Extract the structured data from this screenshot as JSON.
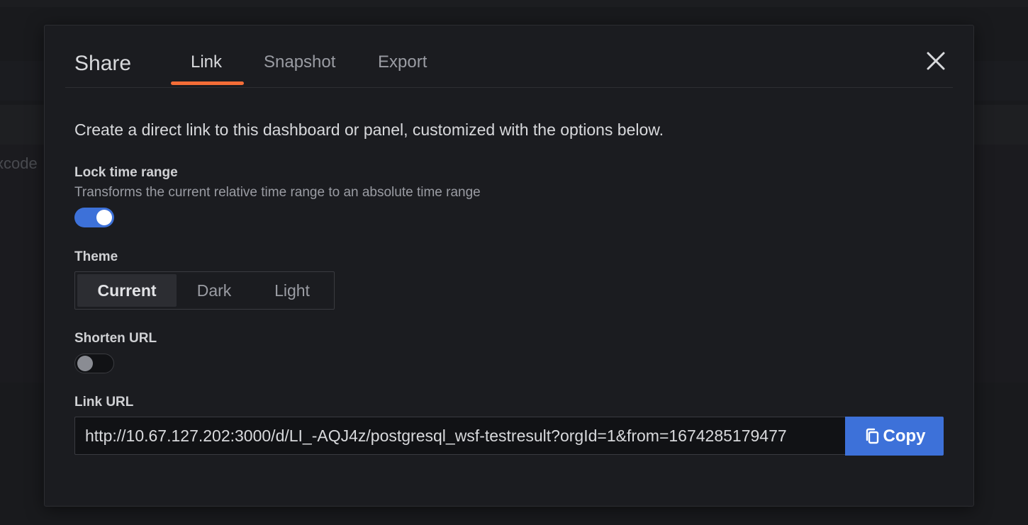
{
  "background": {
    "partial_text": "xcode"
  },
  "modal": {
    "title": "Share",
    "tabs": [
      {
        "label": "Link",
        "active": true
      },
      {
        "label": "Snapshot",
        "active": false
      },
      {
        "label": "Export",
        "active": false
      }
    ],
    "close_icon": "close-icon",
    "description": "Create a direct link to this dashboard or panel, customized with the options below.",
    "lock_time_range": {
      "label": "Lock time range",
      "description": "Transforms the current relative time range to an absolute time range",
      "enabled": true
    },
    "theme": {
      "label": "Theme",
      "options": [
        "Current",
        "Dark",
        "Light"
      ],
      "selected": "Current"
    },
    "shorten_url": {
      "label": "Shorten URL",
      "enabled": false
    },
    "link_url": {
      "label": "Link URL",
      "value": "http://10.67.127.202:3000/d/LI_-AQJ4z/postgresql_wsf-testresult?orgId=1&from=1674285179477",
      "copy_label": "Copy",
      "copy_icon": "copy-icon"
    }
  },
  "colors": {
    "accent_tab": "#f46d37",
    "primary_button": "#3d71d9",
    "switch_on": "#3d71d9"
  }
}
